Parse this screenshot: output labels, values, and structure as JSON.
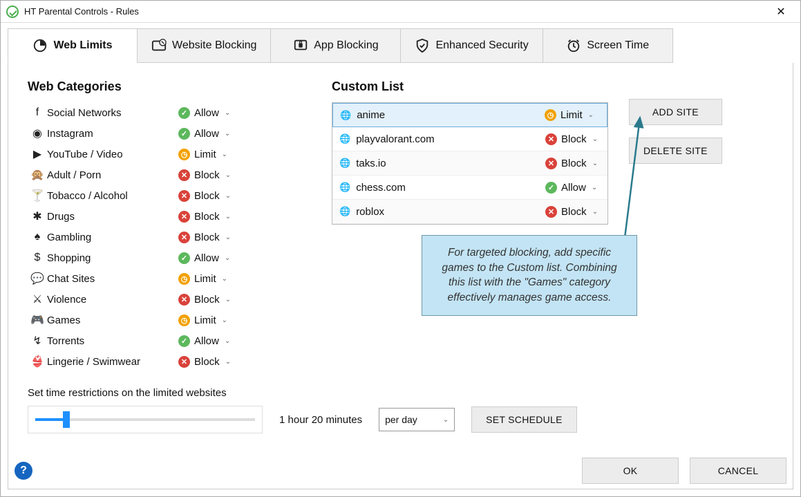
{
  "window": {
    "title": "HT Parental Controls - Rules"
  },
  "tabs": [
    {
      "id": "web-limits",
      "label": "Web Limits",
      "active": true
    },
    {
      "id": "website-blocking",
      "label": "Website Blocking",
      "active": false
    },
    {
      "id": "app-blocking",
      "label": "App Blocking",
      "active": false
    },
    {
      "id": "enhanced-security",
      "label": "Enhanced Security",
      "active": false
    },
    {
      "id": "screen-time",
      "label": "Screen Time",
      "active": false
    }
  ],
  "left": {
    "heading": "Web Categories",
    "categories": [
      {
        "icon": "facebook",
        "label": "Social Networks",
        "status": "Allow"
      },
      {
        "icon": "instagram",
        "label": "Instagram",
        "status": "Allow"
      },
      {
        "icon": "youtube",
        "label": "YouTube / Video",
        "status": "Limit"
      },
      {
        "icon": "adult",
        "label": "Adult / Porn",
        "status": "Block"
      },
      {
        "icon": "alcohol",
        "label": "Tobacco / Alcohol",
        "status": "Block"
      },
      {
        "icon": "drugs",
        "label": "Drugs",
        "status": "Block"
      },
      {
        "icon": "gambling",
        "label": "Gambling",
        "status": "Block"
      },
      {
        "icon": "shopping",
        "label": "Shopping",
        "status": "Allow"
      },
      {
        "icon": "chat",
        "label": "Chat Sites",
        "status": "Limit"
      },
      {
        "icon": "violence",
        "label": "Violence",
        "status": "Block"
      },
      {
        "icon": "games",
        "label": "Games",
        "status": "Limit"
      },
      {
        "icon": "torrents",
        "label": "Torrents",
        "status": "Allow"
      },
      {
        "icon": "lingerie",
        "label": "Lingerie / Swimwear",
        "status": "Block"
      }
    ]
  },
  "right": {
    "heading": "Custom List",
    "items": [
      {
        "site": "anime",
        "status": "Limit",
        "selected": true
      },
      {
        "site": "playvalorant.com",
        "status": "Block",
        "selected": false
      },
      {
        "site": "taks.io",
        "status": "Block",
        "selected": false
      },
      {
        "site": "chess.com",
        "status": "Allow",
        "selected": false
      },
      {
        "site": "roblox",
        "status": "Block",
        "selected": false
      }
    ],
    "buttons": {
      "add": "ADD SITE",
      "delete": "DELETE SITE"
    }
  },
  "callout": "For targeted blocking, add specific games to the Custom list. Combining this list with the \"Games\" category effectively manages game access.",
  "time": {
    "label": "Set time restrictions on the limited websites",
    "value_text": "1 hour 20 minutes",
    "per": "per day",
    "schedule_btn": "SET SCHEDULE"
  },
  "footer": {
    "ok": "OK",
    "cancel": "CANCEL"
  },
  "status_glyphs": {
    "Allow": "✓",
    "Block": "✕",
    "Limit": "◷"
  },
  "cat_glyphs": {
    "facebook": "f",
    "instagram": "◉",
    "youtube": "▶",
    "adult": "🙊",
    "alcohol": "🍸",
    "drugs": "✱",
    "gambling": "♠",
    "shopping": "$",
    "chat": "💬",
    "violence": "⚔",
    "games": "🎮",
    "torrents": "↯",
    "lingerie": "👙"
  }
}
